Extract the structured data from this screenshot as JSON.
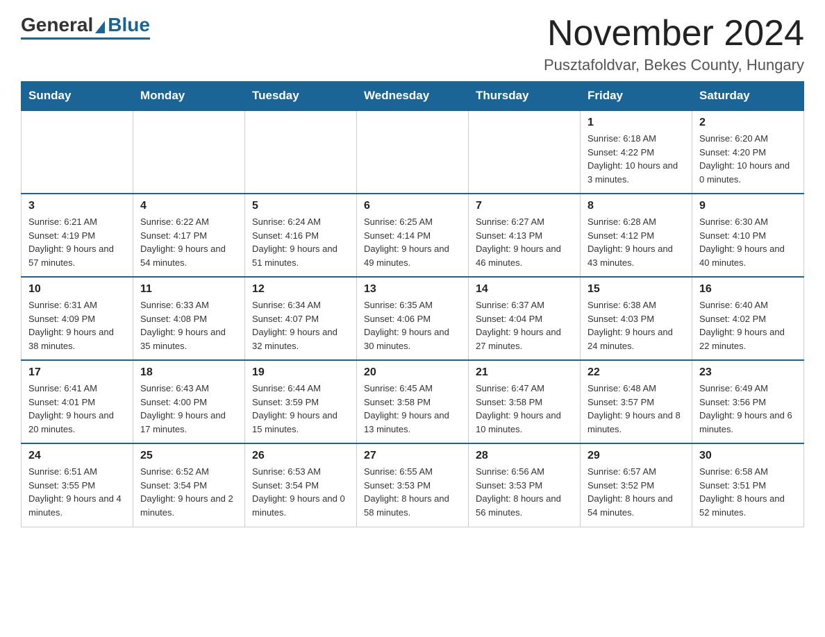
{
  "logo": {
    "general": "General",
    "blue": "Blue"
  },
  "header": {
    "month_title": "November 2024",
    "location": "Pusztafoldvar, Bekes County, Hungary"
  },
  "weekdays": [
    "Sunday",
    "Monday",
    "Tuesday",
    "Wednesday",
    "Thursday",
    "Friday",
    "Saturday"
  ],
  "weeks": [
    [
      {
        "day": "",
        "info": ""
      },
      {
        "day": "",
        "info": ""
      },
      {
        "day": "",
        "info": ""
      },
      {
        "day": "",
        "info": ""
      },
      {
        "day": "",
        "info": ""
      },
      {
        "day": "1",
        "info": "Sunrise: 6:18 AM\nSunset: 4:22 PM\nDaylight: 10 hours and 3 minutes."
      },
      {
        "day": "2",
        "info": "Sunrise: 6:20 AM\nSunset: 4:20 PM\nDaylight: 10 hours and 0 minutes."
      }
    ],
    [
      {
        "day": "3",
        "info": "Sunrise: 6:21 AM\nSunset: 4:19 PM\nDaylight: 9 hours and 57 minutes."
      },
      {
        "day": "4",
        "info": "Sunrise: 6:22 AM\nSunset: 4:17 PM\nDaylight: 9 hours and 54 minutes."
      },
      {
        "day": "5",
        "info": "Sunrise: 6:24 AM\nSunset: 4:16 PM\nDaylight: 9 hours and 51 minutes."
      },
      {
        "day": "6",
        "info": "Sunrise: 6:25 AM\nSunset: 4:14 PM\nDaylight: 9 hours and 49 minutes."
      },
      {
        "day": "7",
        "info": "Sunrise: 6:27 AM\nSunset: 4:13 PM\nDaylight: 9 hours and 46 minutes."
      },
      {
        "day": "8",
        "info": "Sunrise: 6:28 AM\nSunset: 4:12 PM\nDaylight: 9 hours and 43 minutes."
      },
      {
        "day": "9",
        "info": "Sunrise: 6:30 AM\nSunset: 4:10 PM\nDaylight: 9 hours and 40 minutes."
      }
    ],
    [
      {
        "day": "10",
        "info": "Sunrise: 6:31 AM\nSunset: 4:09 PM\nDaylight: 9 hours and 38 minutes."
      },
      {
        "day": "11",
        "info": "Sunrise: 6:33 AM\nSunset: 4:08 PM\nDaylight: 9 hours and 35 minutes."
      },
      {
        "day": "12",
        "info": "Sunrise: 6:34 AM\nSunset: 4:07 PM\nDaylight: 9 hours and 32 minutes."
      },
      {
        "day": "13",
        "info": "Sunrise: 6:35 AM\nSunset: 4:06 PM\nDaylight: 9 hours and 30 minutes."
      },
      {
        "day": "14",
        "info": "Sunrise: 6:37 AM\nSunset: 4:04 PM\nDaylight: 9 hours and 27 minutes."
      },
      {
        "day": "15",
        "info": "Sunrise: 6:38 AM\nSunset: 4:03 PM\nDaylight: 9 hours and 24 minutes."
      },
      {
        "day": "16",
        "info": "Sunrise: 6:40 AM\nSunset: 4:02 PM\nDaylight: 9 hours and 22 minutes."
      }
    ],
    [
      {
        "day": "17",
        "info": "Sunrise: 6:41 AM\nSunset: 4:01 PM\nDaylight: 9 hours and 20 minutes."
      },
      {
        "day": "18",
        "info": "Sunrise: 6:43 AM\nSunset: 4:00 PM\nDaylight: 9 hours and 17 minutes."
      },
      {
        "day": "19",
        "info": "Sunrise: 6:44 AM\nSunset: 3:59 PM\nDaylight: 9 hours and 15 minutes."
      },
      {
        "day": "20",
        "info": "Sunrise: 6:45 AM\nSunset: 3:58 PM\nDaylight: 9 hours and 13 minutes."
      },
      {
        "day": "21",
        "info": "Sunrise: 6:47 AM\nSunset: 3:58 PM\nDaylight: 9 hours and 10 minutes."
      },
      {
        "day": "22",
        "info": "Sunrise: 6:48 AM\nSunset: 3:57 PM\nDaylight: 9 hours and 8 minutes."
      },
      {
        "day": "23",
        "info": "Sunrise: 6:49 AM\nSunset: 3:56 PM\nDaylight: 9 hours and 6 minutes."
      }
    ],
    [
      {
        "day": "24",
        "info": "Sunrise: 6:51 AM\nSunset: 3:55 PM\nDaylight: 9 hours and 4 minutes."
      },
      {
        "day": "25",
        "info": "Sunrise: 6:52 AM\nSunset: 3:54 PM\nDaylight: 9 hours and 2 minutes."
      },
      {
        "day": "26",
        "info": "Sunrise: 6:53 AM\nSunset: 3:54 PM\nDaylight: 9 hours and 0 minutes."
      },
      {
        "day": "27",
        "info": "Sunrise: 6:55 AM\nSunset: 3:53 PM\nDaylight: 8 hours and 58 minutes."
      },
      {
        "day": "28",
        "info": "Sunrise: 6:56 AM\nSunset: 3:53 PM\nDaylight: 8 hours and 56 minutes."
      },
      {
        "day": "29",
        "info": "Sunrise: 6:57 AM\nSunset: 3:52 PM\nDaylight: 8 hours and 54 minutes."
      },
      {
        "day": "30",
        "info": "Sunrise: 6:58 AM\nSunset: 3:51 PM\nDaylight: 8 hours and 52 minutes."
      }
    ]
  ]
}
